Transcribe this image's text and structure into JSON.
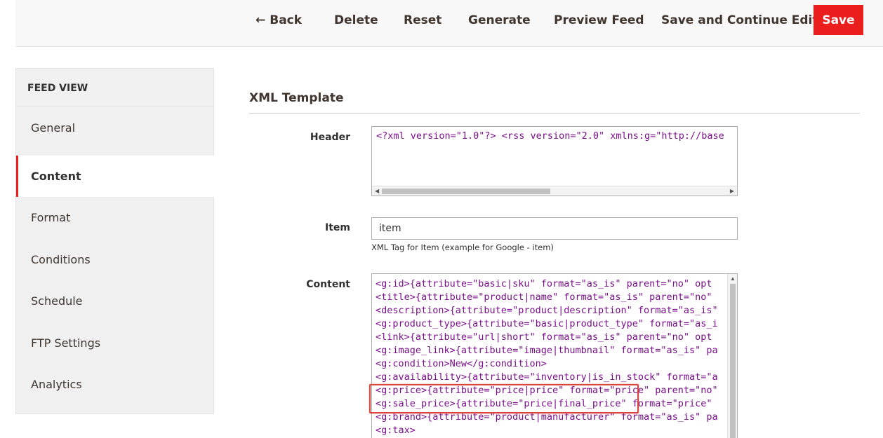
{
  "toolbar": {
    "back_label": "Back",
    "back_icon": "arrow-left-icon",
    "delete_label": "Delete",
    "reset_label": "Reset",
    "generate_label": "Generate",
    "preview_label": "Preview Feed",
    "save_continue_label": "Save and Continue Edit",
    "save_label": "Save",
    "save_color": "#eb1d1d"
  },
  "sidenav": {
    "title": "FEED VIEW",
    "items": [
      {
        "label": "General"
      },
      {
        "label": "Content"
      },
      {
        "label": "Format"
      },
      {
        "label": "Conditions"
      },
      {
        "label": "Schedule"
      },
      {
        "label": "FTP Settings"
      },
      {
        "label": "Analytics"
      }
    ],
    "active": "Content",
    "active_color": "#eb1d1d"
  },
  "main": {
    "section_title": "XML Template",
    "header_field": {
      "label": "Header",
      "value": "<?xml version=\"1.0\"?> <rss version=\"2.0\" xmlns:g=\"http://base"
    },
    "item_field": {
      "label": "Item",
      "value": "item",
      "note": "XML Tag for Item (example for Google - item)"
    },
    "content_field": {
      "label": "Content",
      "lines": [
        "<g:id>{attribute=\"basic|sku\" format=\"as_is\" parent=\"no\" opt",
        "<title>{attribute=\"product|name\" format=\"as_is\" parent=\"no\"",
        "<description>{attribute=\"product|description\" format=\"as_is\"",
        "<g:product_type>{attribute=\"basic|product_type\" format=\"as_i",
        "<link>{attribute=\"url|short\" format=\"as_is\" parent=\"no\" opt",
        "<g:image_link>{attribute=\"image|thumbnail\" format=\"as_is\" pa",
        "<g:condition>New</g:condition>",
        "<g:availability>{attribute=\"inventory|is_in_stock\" format=\"a",
        "<g:price>{attribute=\"price|price\" format=\"price\" parent=\"no\"",
        "<g:sale_price>{attribute=\"price|final_price\" format=\"price\"",
        "<g:brand>{attribute=\"product|manufacturer\" format=\"as_is\" pa",
        "<g:tax>"
      ],
      "highlight_color": "#d9453d"
    }
  }
}
